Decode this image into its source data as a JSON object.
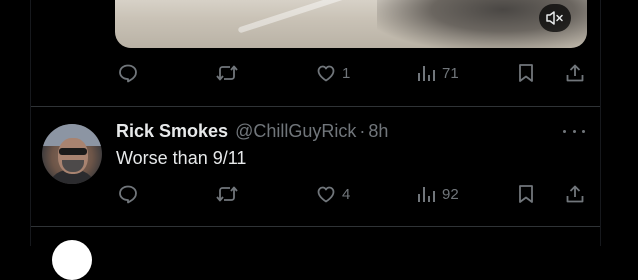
{
  "previous_post": {
    "media": {
      "mute_icon": "speaker-muted-icon"
    },
    "actions": {
      "reply": {
        "icon": "reply-icon",
        "count": ""
      },
      "repost": {
        "icon": "repost-icon",
        "count": ""
      },
      "like": {
        "icon": "heart-icon",
        "count": "1"
      },
      "views": {
        "icon": "views-bar-icon",
        "count": "71"
      },
      "bookmark": {
        "icon": "bookmark-icon"
      },
      "share": {
        "icon": "share-icon"
      }
    }
  },
  "reply_post": {
    "author_name": "Rick Smokes",
    "handle": "@ChillGuyRick",
    "separator": "·",
    "time": "8h",
    "text": "Worse than 9/11",
    "actions": {
      "reply": {
        "icon": "reply-icon",
        "count": ""
      },
      "repost": {
        "icon": "repost-icon",
        "count": ""
      },
      "like": {
        "icon": "heart-icon",
        "count": "4"
      },
      "views": {
        "icon": "views-bar-icon",
        "count": "92"
      },
      "bookmark": {
        "icon": "bookmark-icon"
      },
      "share": {
        "icon": "share-icon"
      }
    }
  },
  "colors": {
    "background": "#000000",
    "primary_text": "#e7e9ea",
    "secondary_text": "#71767b",
    "divider": "#2f3336"
  }
}
